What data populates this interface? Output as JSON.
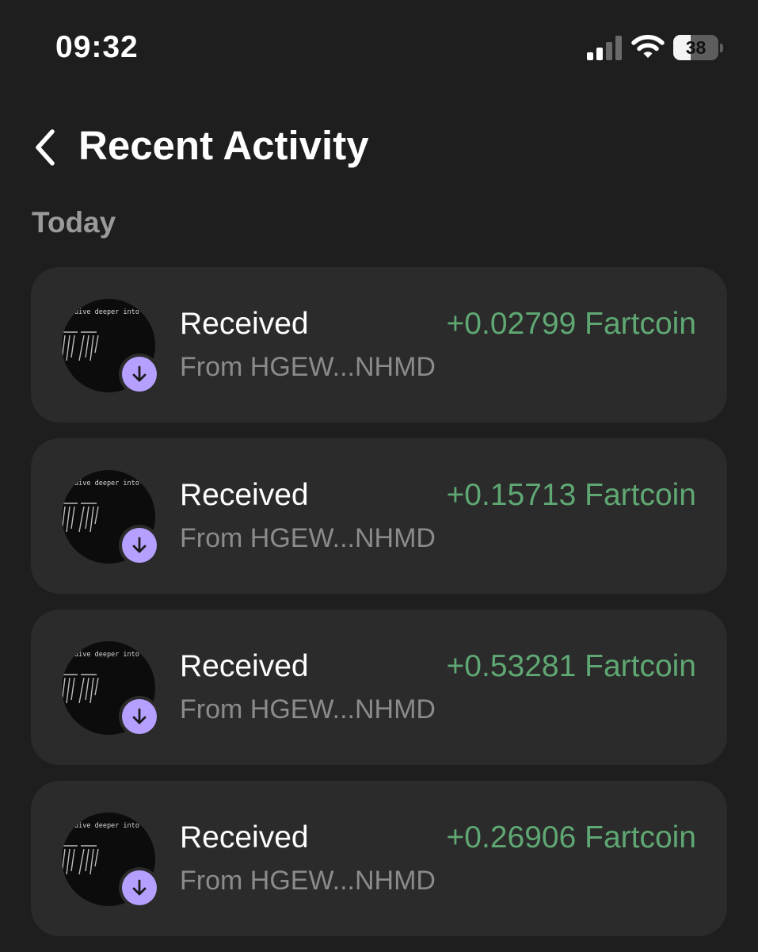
{
  "status_bar": {
    "time": "09:32",
    "battery_percent": 38,
    "battery_label": "38",
    "signal_bars_active": 2,
    "signal_bars_total": 4,
    "icons": [
      "cellular-signal-icon",
      "wifi-icon",
      "battery-icon"
    ]
  },
  "header": {
    "back_icon": "chevron-left-icon",
    "title": "Recent Activity"
  },
  "section": {
    "heading": "Today"
  },
  "activities": [
    {
      "type": "Received",
      "from": "From HGEW...NHMD",
      "amount": "+0.02799 Fartcoin",
      "avatar_caption": "dive deeper into this",
      "badge_icon": "arrow-down-icon"
    },
    {
      "type": "Received",
      "from": "From HGEW...NHMD",
      "amount": "+0.15713 Fartcoin",
      "avatar_caption": "dive deeper into this",
      "badge_icon": "arrow-down-icon"
    },
    {
      "type": "Received",
      "from": "From HGEW...NHMD",
      "amount": "+0.53281 Fartcoin",
      "avatar_caption": "dive deeper into this",
      "badge_icon": "arrow-down-icon"
    },
    {
      "type": "Received",
      "from": "From HGEW...NHMD",
      "amount": "+0.26906 Fartcoin",
      "avatar_caption": "dive deeper into this",
      "badge_icon": "arrow-down-icon"
    }
  ],
  "colors": {
    "background": "#1e1e1e",
    "card": "#2b2b2b",
    "amount_positive": "#5fa873",
    "badge": "#b6a0ff",
    "secondary_text": "#8b8b8b",
    "section_heading": "#9a9a9a"
  }
}
